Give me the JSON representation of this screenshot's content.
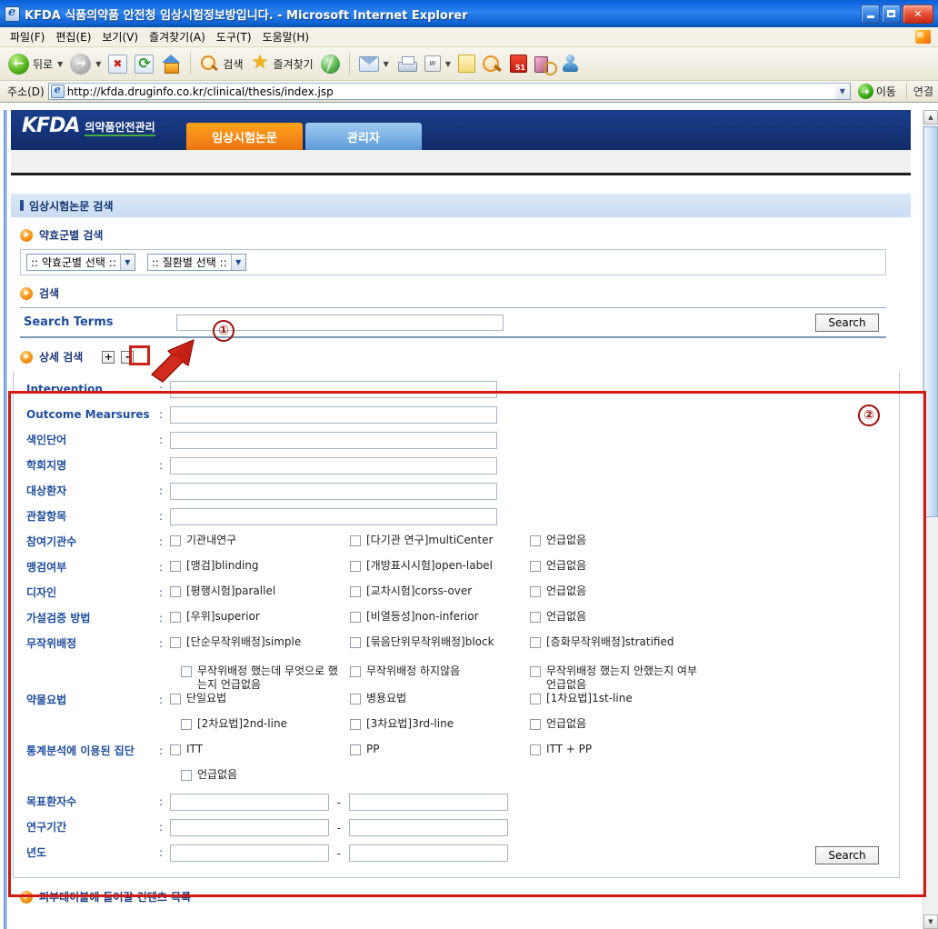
{
  "browser": {
    "title": "KFDA 식품의약품 안전청 임상시험정보방입니다. - Microsoft Internet Explorer",
    "window_controls": {
      "minimize": "_",
      "maximize": "□",
      "close": "✕"
    },
    "menu": [
      {
        "label": "파일(F)"
      },
      {
        "label": "편집(E)"
      },
      {
        "label": "보기(V)"
      },
      {
        "label": "즐겨찾기(A)"
      },
      {
        "label": "도구(T)"
      },
      {
        "label": "도움말(H)"
      }
    ],
    "toolbar": {
      "back": "뒤로",
      "search": "검색",
      "favorites": "즐겨찾기"
    },
    "address": {
      "label": "주소(D)",
      "url": "http://kfda.druginfo.co.kr/clinical/thesis/index.jsp",
      "go": "이동",
      "links": "연결"
    }
  },
  "site": {
    "logo": "KFDA",
    "logo_sub": "의약품안전관리",
    "tabs": [
      {
        "label": "임상시험논문",
        "active": true
      },
      {
        "label": "관리자",
        "active": false
      }
    ]
  },
  "section": {
    "title": "임상시험논문 검색"
  },
  "drug_group": {
    "heading": "약효군별 검색",
    "selects": [
      {
        "value": ":: 약효군별 선택 ::"
      },
      {
        "value": ":: 질환별 선택 ::"
      }
    ]
  },
  "search": {
    "heading": "검색",
    "terms_label": "Search Terms",
    "terms_value": "",
    "button": "Search"
  },
  "advanced": {
    "heading": "상세 검색",
    "expand": "+",
    "collapse": "-",
    "search_button": "Search",
    "text_fields": [
      {
        "label": "Intervention",
        "value": ""
      },
      {
        "label": "Outcome Mearsures",
        "value": ""
      },
      {
        "label": "색인단어",
        "value": ""
      },
      {
        "label": "학회지명",
        "value": ""
      },
      {
        "label": "대상환자",
        "value": ""
      },
      {
        "label": "관찰항목",
        "value": ""
      }
    ],
    "checkbox_groups": [
      {
        "label": "참여기관수",
        "rows": [
          [
            "기관내연구",
            "[다기관 연구]multiCenter",
            "언급없음"
          ]
        ]
      },
      {
        "label": "맹검여부",
        "rows": [
          [
            "[맹검]blinding",
            "[개방표시시험]open-label",
            "언급없음"
          ]
        ]
      },
      {
        "label": "디자인",
        "rows": [
          [
            "[평행시험]parallel",
            "[교차시험]corss-over",
            "언급없음"
          ]
        ]
      },
      {
        "label": "가설검증 방법",
        "rows": [
          [
            "[우위]superior",
            "[비열등성]non-inferior",
            "언급없음"
          ]
        ]
      },
      {
        "label": "무작위배정",
        "rows": [
          [
            "[단순무작위배정]simple",
            "[묶음단위무작위배정]block",
            "[층화무작위배정]stratified"
          ],
          [
            "무작위배정 했는데 무엇으로 했는지 언급없음",
            "무작위배정 하지않음",
            "무작위배정 했는지 안했는지 여부 언급없음"
          ]
        ]
      },
      {
        "label": "약물요법",
        "rows": [
          [
            "단일요법",
            "병용요법",
            "[1차요법]1st-line"
          ],
          [
            "[2차요법]2nd-line",
            "[3차요법]3rd-line",
            "언급없음"
          ]
        ]
      },
      {
        "label": "통계분석에 이용된 집단",
        "rows": [
          [
            "ITT",
            "PP",
            "ITT + PP"
          ],
          [
            "언급없음",
            "",
            ""
          ]
        ]
      }
    ],
    "range_fields": [
      {
        "label": "목표환자수",
        "from": "",
        "to": "",
        "separator": "-"
      },
      {
        "label": "연구기간",
        "from": "",
        "to": "",
        "separator": "-"
      },
      {
        "label": "년도",
        "from": "",
        "to": "",
        "separator": "-"
      }
    ]
  },
  "footer": {
    "heading": "피부테이블에 들어갈 컨텐츠 목록"
  },
  "annotations": [
    {
      "id": "1",
      "label": "①"
    },
    {
      "id": "2",
      "label": "②"
    }
  ],
  "colors": {
    "accent_orange": "#f5871a",
    "header_blue": "#16357a",
    "label_blue": "#1f4d9e",
    "annotation_red": "#9e0b0b",
    "highlight_red": "#d11a12"
  }
}
